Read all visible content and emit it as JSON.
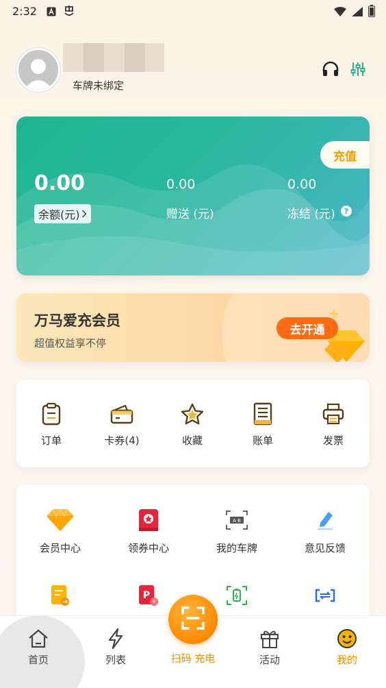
{
  "status_bar": {
    "time": "2:32",
    "icons_left": [
      "a-icon",
      "notification-icon"
    ],
    "icons_right": [
      "wifi-icon",
      "signal-icon",
      "battery-icon"
    ]
  },
  "profile": {
    "plate_status": "车牌未绑定",
    "icons": [
      "headset-icon",
      "settings-sliders-icon"
    ]
  },
  "balance": {
    "recharge_label": "充值",
    "main": {
      "value": "0.00",
      "label": "余额(元)"
    },
    "gift": {
      "value": "0.00",
      "label": "赠送 (元)"
    },
    "frozen": {
      "value": "0.00",
      "label": "冻结 (元)"
    }
  },
  "membership": {
    "title": "万马爱充会员",
    "subtitle": "超值权益享不停",
    "button": "去开通"
  },
  "quick_actions": [
    {
      "label": "订单",
      "icon": "clipboard-icon"
    },
    {
      "label": "卡券(4)",
      "icon": "wallet-icon"
    },
    {
      "label": "收藏",
      "icon": "star-icon"
    },
    {
      "label": "账单",
      "icon": "ledger-icon"
    },
    {
      "label": "发票",
      "icon": "printer-icon"
    }
  ],
  "services": [
    {
      "label": "会员中心",
      "icon": "diamond-icon"
    },
    {
      "label": "领券中心",
      "icon": "coupon-icon"
    },
    {
      "label": "我的车牌",
      "icon": "license-plate-icon"
    },
    {
      "label": "意见反馈",
      "icon": "feedback-icon"
    },
    {
      "label": "",
      "icon": "document-icon"
    },
    {
      "label": "",
      "icon": "parking-coupon-icon"
    },
    {
      "label": "",
      "icon": "battery-check-icon"
    },
    {
      "label": "",
      "icon": "vin-icon"
    }
  ],
  "tabbar": {
    "tabs": [
      {
        "label": "首页",
        "icon": "home-icon"
      },
      {
        "label": "列表",
        "icon": "lightning-icon"
      },
      {
        "label": "扫码 充电",
        "icon": "scan-icon"
      },
      {
        "label": "活动",
        "icon": "gift-icon"
      },
      {
        "label": "我的",
        "icon": "smile-icon"
      }
    ]
  },
  "colors": {
    "accent": "#ff8a00",
    "primary_green": "#1fb58f",
    "tab_active": "#f29000"
  }
}
